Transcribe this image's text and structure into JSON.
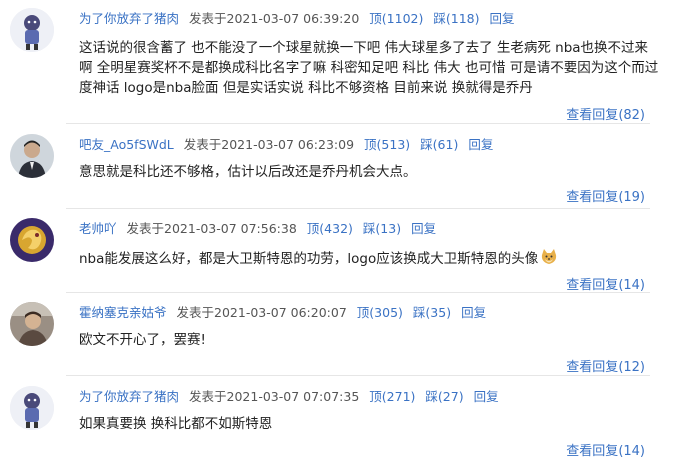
{
  "labels": {
    "posted": "发表于",
    "up": "顶",
    "down": "踩",
    "reply": "回复",
    "view_replies": "查看回复"
  },
  "comments": [
    {
      "user": "为了你放弃了猪肉",
      "time": "2021-03-07 06:39:20",
      "up": "(1102)",
      "down": "(118)",
      "text": "这话说的很含蓄了 也不能没了一个球星就换一下吧 伟大球星多了去了 生老病死 nba也换不过来啊 全明星赛奖杯不是都换成科比名字了嘛 科密知足吧 科比 伟大 也可惜 可是请不要因为这个而过度神话 logo是nba脸面 但是实话实说 科比不够资格 目前来说 换就得是乔丹",
      "replies": "(82)",
      "avatar_icon": "anime-character-avatar"
    },
    {
      "user": "吧友_Ao5fSWdL",
      "time": "2021-03-07 06:23:09",
      "up": "(513)",
      "down": "(61)",
      "text": "意思就是科比还不够格，估计以后改还是乔丹机会大点。",
      "replies": "(19)",
      "avatar_icon": "man-in-suit-avatar"
    },
    {
      "user": "老帅吖",
      "time": "2021-03-07 07:56:38",
      "up": "(432)",
      "down": "(13)",
      "text": "nba能发展这么好，都是大卫斯特恩的功劳，logo应该换成大卫斯特恩的头像",
      "replies": "(14)",
      "avatar_icon": "gold-dragon-avatar",
      "emoji": "doge-emoji"
    },
    {
      "user": "霍纳塞克亲姑爷",
      "time": "2021-03-07 06:20:07",
      "up": "(305)",
      "down": "(35)",
      "text": "欧文不开心了，罢赛!",
      "replies": "(12)",
      "avatar_icon": "photo-person-avatar"
    },
    {
      "user": "为了你放弃了猪肉",
      "time": "2021-03-07 07:07:35",
      "up": "(271)",
      "down": "(27)",
      "text": "如果真要换 换科比都不如斯特恩",
      "replies": "(14)",
      "avatar_icon": "anime-character-avatar"
    }
  ]
}
